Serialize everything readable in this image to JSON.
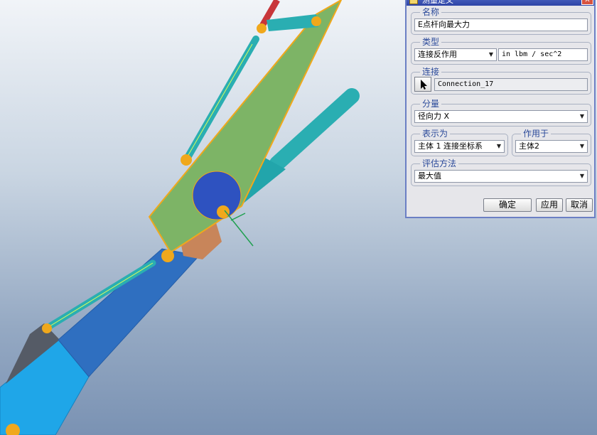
{
  "dialog": {
    "title": "测量定义",
    "close_glyph": "✕",
    "name": {
      "label": "名称",
      "value": "E点杆向最大力"
    },
    "type": {
      "label": "类型",
      "selected": "连接反作用",
      "units": "in lbm / sec^2"
    },
    "connection": {
      "label": "连接",
      "value": "Connection_17"
    },
    "component": {
      "label": "分量",
      "selected": "径向力 X"
    },
    "express_in": {
      "label": "表示为",
      "selected": "主体 1 连接坐标系"
    },
    "applies_to": {
      "label": "作用于",
      "selected": "主体2"
    },
    "evaluation": {
      "label": "评估方法",
      "selected": "最大值"
    },
    "buttons": {
      "ok": "确定",
      "apply": "应用",
      "cancel": "取消"
    }
  },
  "icons": {
    "title": "measure-dialog-icon",
    "pick": "arrow-cursor-icon",
    "dropdown": "chevron-down-icon",
    "close": "close-icon"
  },
  "colors": {
    "title_bar": "#3a52b3",
    "group_label": "#2b4a9a",
    "model_green": "#7db466",
    "model_orange": "#f0a81c",
    "model_teal": "#2aaeb2",
    "model_blue": "#2f6fc0",
    "model_light_blue": "#1fa6e8"
  }
}
